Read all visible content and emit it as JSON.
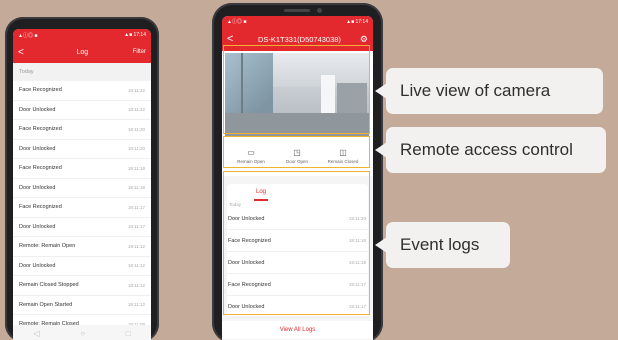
{
  "phone1": {
    "status_left": "▲ⓘ◎ ■",
    "status_right": "▲■ 17:14",
    "header": {
      "back": "<",
      "title": "Log",
      "filter": "Filter"
    },
    "section": "Today",
    "rows": [
      {
        "label": "Face Recognized",
        "time": "19:11:22"
      },
      {
        "label": "Door Unlocked",
        "time": "19:11:22"
      },
      {
        "label": "Face Recognized",
        "time": "19:11:20"
      },
      {
        "label": "Door Unlocked",
        "time": "19:11:20"
      },
      {
        "label": "Face Recognized",
        "time": "19:11:18"
      },
      {
        "label": "Door Unlocked",
        "time": "19:11:18"
      },
      {
        "label": "Face Recognized",
        "time": "19:11:17"
      },
      {
        "label": "Door Unlocked",
        "time": "19:11:17"
      },
      {
        "label": "Remote: Remain Open",
        "time": "19:11:12"
      },
      {
        "label": "Door Unlocked",
        "time": "19:11:12"
      },
      {
        "label": "Remain Closed Stopped",
        "time": "19:11:12"
      },
      {
        "label": "Remain Open Started",
        "time": "19:11:12"
      },
      {
        "label": "Remote: Remain Closed",
        "time": "19:11:09"
      }
    ],
    "nav": {
      "back": "◁",
      "home": "○",
      "recent": "□"
    }
  },
  "phone2": {
    "status_left": "▲ⓘ◎ ■",
    "status_right": "▲■ 17:14",
    "header": {
      "back": "<",
      "title": "DS-K1T331(D50743038)",
      "settings": "⚙"
    },
    "controls": [
      {
        "icon": "▭",
        "label": "Remain Open"
      },
      {
        "icon": "◳",
        "label": "Door Open"
      },
      {
        "icon": "◫",
        "label": "Remain Closed"
      }
    ],
    "log_tab": "Log",
    "today": "Today",
    "rows": [
      {
        "label": "Door Unlocked",
        "time": "19:11:20"
      },
      {
        "label": "Face Recognized",
        "time": "19:11:18"
      },
      {
        "label": "Door Unlocked",
        "time": "19:11:18"
      },
      {
        "label": "Face Recognized",
        "time": "19:11:17"
      },
      {
        "label": "Door Unlocked",
        "time": "19:11:17"
      }
    ],
    "view_all": "View All Logs"
  },
  "callouts": {
    "live_view": "Live view of camera",
    "remote_access": "Remote access control",
    "event_logs": "Event logs"
  },
  "colors": {
    "accent_red": "#e3292e",
    "highlight": "#f2b133",
    "background": "#c4aa98"
  }
}
